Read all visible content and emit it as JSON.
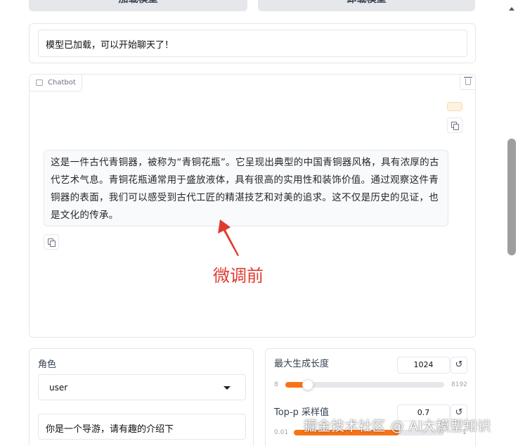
{
  "top_buttons": {
    "load_label": "加载模型",
    "unload_label": "卸载模型"
  },
  "status": {
    "value": "模型已加载，可以开始聊天了！"
  },
  "chatbot": {
    "label": "Chatbot",
    "bot_message": "这是一件古代青铜器，被称为“青铜花瓶”。它呈现出典型的中国青铜器风格，具有浓厚的古代艺术气息。青铜花瓶通常用于盛放液体，具有很高的实用性和装饰价值。通过观察这件青铜器的表面，我们可以感受到古代工匠的精湛技艺和对美的追求。这不仅是历史的见证，也是文化的传承。",
    "annotation": "微调前",
    "annotation_color": "#e03a2f",
    "user_bubble_color": "#fef3e2"
  },
  "role": {
    "label": "角色",
    "selected": "user"
  },
  "prompt": {
    "value": "你是一个导游，请有趣的介绍下"
  },
  "max_length": {
    "label": "最大生成长度",
    "value": "1024",
    "min": "8",
    "max": "8192",
    "fraction": 0.125
  },
  "top_p": {
    "label": "Top-p 采样值",
    "value": "0.7",
    "min": "0.01",
    "max": "1",
    "fraction": 0.7
  },
  "reset_glyph": "↺",
  "watermark": "掘金技术社区 @ AI大模型知识",
  "accent_color": "#f97316"
}
